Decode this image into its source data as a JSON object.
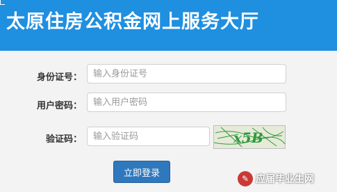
{
  "header": {
    "title": "太原住房公积金网上服务大厅"
  },
  "form": {
    "id_label": "身份证号：",
    "id_placeholder": "输入身份证号",
    "password_label": "用户密码：",
    "password_placeholder": "输入用户密码",
    "captcha_label": "验证码：",
    "captcha_placeholder": "输入验证码",
    "captcha_text": "x5B",
    "login_label": "立即登录"
  },
  "watermark": {
    "text": "应届毕业生网"
  },
  "colors": {
    "header_bg": "#1f8fe0",
    "button_bg": "#2f78bd",
    "captcha_ink": "#2e9a3e"
  }
}
